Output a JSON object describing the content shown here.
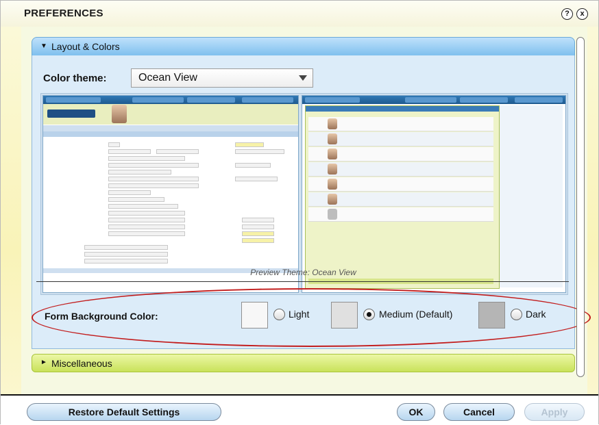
{
  "window": {
    "title": "PREFERENCES",
    "help_symbol": "?",
    "close_symbol": "x"
  },
  "sections": {
    "layout": {
      "label": "Layout & Colors",
      "expanded": true
    },
    "misc": {
      "label": "Miscellaneous",
      "expanded": false
    }
  },
  "color_theme": {
    "label": "Color theme:",
    "selected": "Ocean View"
  },
  "preview": {
    "caption": "Preview Theme: Ocean View"
  },
  "form_background": {
    "label": "Form Background Color:",
    "options": [
      {
        "label": "Light",
        "color": "#f7f7f7",
        "selected": false
      },
      {
        "label": "Medium (Default)",
        "color": "#e0e0e0",
        "selected": true
      },
      {
        "label": "Dark",
        "color": "#b5b5b5",
        "selected": false
      }
    ]
  },
  "footer": {
    "restore_label": "Restore Default Settings",
    "ok_label": "OK",
    "cancel_label": "Cancel",
    "apply_label": "Apply"
  },
  "colors": {
    "accent_blue": "#7fc0ee",
    "accent_green": "#c9e25a",
    "highlight_red": "#c21d1d"
  }
}
